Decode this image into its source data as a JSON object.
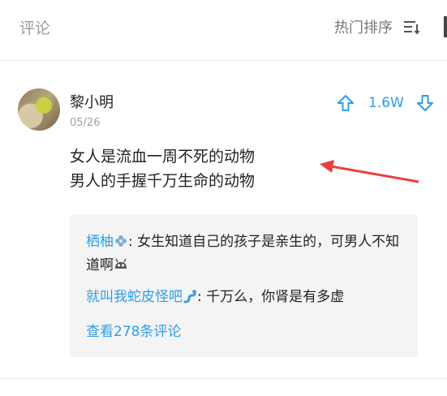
{
  "header": {
    "title": "评论",
    "sort_label": "热门排序"
  },
  "comment": {
    "username": "黎小明",
    "date": "05/26",
    "votes": "1.6W",
    "lines": [
      "女人是流血一周不死的动物",
      "男人的手握千万生命的动物"
    ]
  },
  "replies": [
    {
      "name": "栖柚",
      "name_icon": "flower-icon",
      "text": ": 女生知道自己的孩子是亲生的，可男人不知道啊",
      "trailing_icon": "face-emoji-icon"
    },
    {
      "name": "就叫我蛇皮怪吧",
      "name_icon": "snake-emoji-icon",
      "text": ": 千万么，你肾是有多虚"
    }
  ],
  "view_more": "查看278条评论",
  "colors": {
    "accent": "#2f9de6",
    "arrow": "#e8413c",
    "reply_bg": "#f4f4f4"
  }
}
